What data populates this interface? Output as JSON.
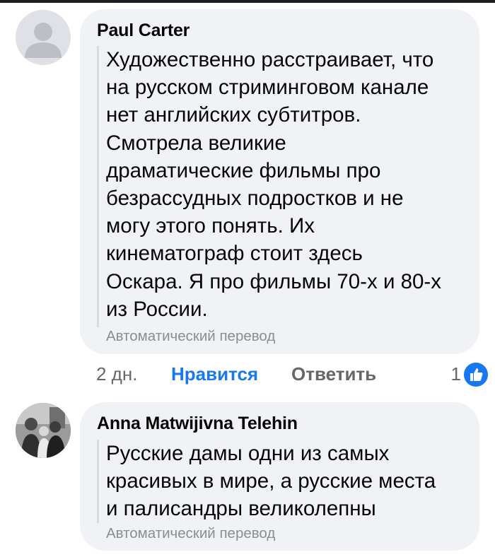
{
  "comments": [
    {
      "author": "Paul Carter",
      "text": "Художественно расстраивает, что\nна русском стриминговом канале\nнет английских субтитров.\nСмотрела великие\nдраматические фильмы про\nбезрассудных подростков и не\nмогу этого понять. Их\nкинематограф стоит здесь\nОскара. Я про фильмы 70-х и 80-х\nиз России.",
      "auto_translate": "Автоматический перевод",
      "time": "2 дн.",
      "like_label": "Нравится",
      "reply_label": "Ответить",
      "reaction_count": "1",
      "reaction_icon": "thumbs-up-icon",
      "avatar": "default-avatar-icon"
    },
    {
      "author": "Anna Matwijivna Telehin",
      "text": "Русские дамы одни из самых\nкрасивых в мире, а русские места\nи палисандры великолепны",
      "auto_translate": "Автоматический перевод",
      "avatar": "photo-avatar"
    }
  ],
  "colors": {
    "bubble": "#f0f2f5",
    "like_active": "#1877f2",
    "muted": "#65676b",
    "auto_translate": "#8a8d91"
  }
}
